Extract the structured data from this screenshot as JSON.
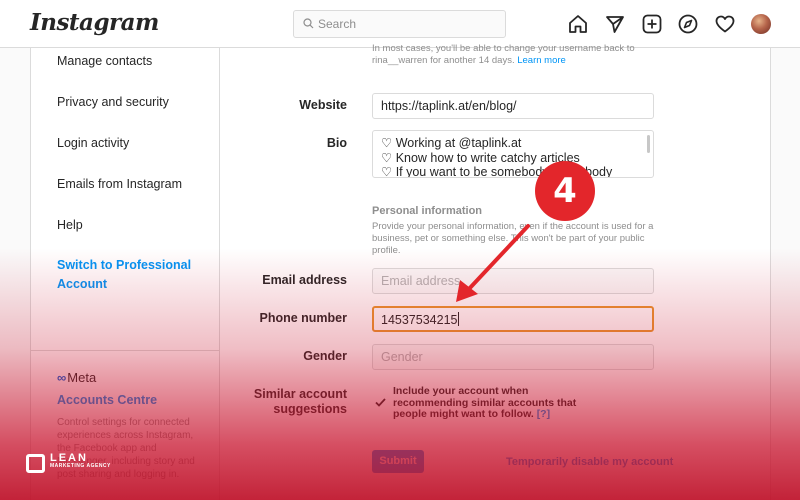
{
  "header": {
    "logo": "Instagram",
    "search_placeholder": "Search",
    "icons": [
      "home-icon",
      "direct-message-icon",
      "new-post-icon",
      "explore-icon",
      "activity-heart-icon",
      "profile-avatar"
    ]
  },
  "sidebar": {
    "items": [
      {
        "label": "Manage contacts"
      },
      {
        "label": "Privacy and security"
      },
      {
        "label": "Login activity"
      },
      {
        "label": "Emails from Instagram"
      },
      {
        "label": "Help"
      }
    ],
    "pro_label": "Switch to Professional Account",
    "meta_logo": "Meta",
    "accounts_centre": "Accounts Centre",
    "accounts_desc": "Control settings for connected experiences across Instagram, the Facebook app and Messenger, including story and post sharing and logging in."
  },
  "form": {
    "username_note": "In most cases, you'll be able to change your username back to rina__warren for another 14 days.",
    "learn_more": "Learn more",
    "website_label": "Website",
    "website_value": "https://taplink.at/en/blog/",
    "bio_label": "Bio",
    "bio_lines": [
      "Working at @taplink.at",
      "Know how to write catchy articles",
      "If you want to be somebody, somebody"
    ],
    "personal_title": "Personal information",
    "personal_desc": "Provide your personal information, even if the account is used for a business, pet or something else. This won't be part of your public profile.",
    "email_label": "Email address",
    "email_placeholder": "Email address",
    "phone_label": "Phone number",
    "phone_value": "14537534215",
    "gender_label": "Gender",
    "gender_placeholder": "Gender",
    "similar_label": "Similar account suggestions",
    "similar_text": "Include your account when recommending similar accounts that people might want to follow.",
    "similar_help": "[?]",
    "similar_checked": true,
    "submit_label": "Submit",
    "disable_label": "Temporarily disable my account"
  },
  "annotation": {
    "step_number": "4",
    "badge_color": "#e3262b"
  },
  "watermark": {
    "brand": "LEAN",
    "tagline": "MARKETING AGENCY"
  },
  "colors": {
    "link_blue": "#0095f6",
    "focus_orange": "#e8962f",
    "overlay_red": "#c8142e"
  }
}
